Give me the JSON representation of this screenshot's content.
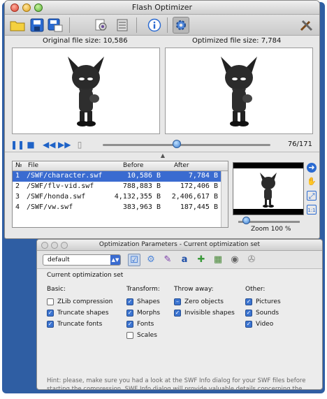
{
  "main_window": {
    "title": "Flash Optimizer",
    "toolbar": {
      "buttons": [
        {
          "name": "open-folder-icon",
          "glyph": "📂"
        },
        {
          "name": "save-icon",
          "glyph": "💾"
        },
        {
          "name": "save-as-icon",
          "glyph": "🖫"
        },
        {
          "name": "optimize-icon",
          "glyph": "⚙"
        },
        {
          "name": "batch-icon",
          "glyph": "🗎"
        },
        {
          "name": "info-icon",
          "glyph": "ℹ"
        },
        {
          "name": "settings-icon",
          "glyph": "⚙"
        },
        {
          "name": "tools-icon",
          "glyph": "🛠"
        }
      ]
    },
    "original_label": "Original file size: 10,586",
    "optimized_label": "Optimized file size: 7,784",
    "frame_counter": "76/171",
    "playback_progress": 0.44,
    "table": {
      "headers": [
        "№",
        "File",
        "Before",
        "After"
      ],
      "rows": [
        {
          "num": "1",
          "file": "/SWF/character.swf",
          "before": "10,586 B",
          "after": "7,784 B",
          "selected": true
        },
        {
          "num": "2",
          "file": "/SWF/flv-vid.swf",
          "before": "788,883 B",
          "after": "172,406 B",
          "selected": false
        },
        {
          "num": "3",
          "file": "/SWF/honda.swf",
          "before": "4,132,355 B",
          "after": "2,406,617 B",
          "selected": false
        },
        {
          "num": "4",
          "file": "/SWF/vw.swf",
          "before": "383,963 B",
          "after": "187,445 B",
          "selected": false
        }
      ]
    },
    "zoom_label": "Zoom 100 %",
    "zoom_level": 0.12
  },
  "opt_window": {
    "title": "Optimization Parameters - Current optimization set",
    "preset_value": "default",
    "set_title": "Current optimization set",
    "columns": {
      "basic": "Basic:",
      "transform": "Transform:",
      "throw_away": "Throw away:",
      "other": "Other:"
    },
    "basic": [
      {
        "label": "ZLib compression",
        "state": "off"
      },
      {
        "label": "Truncate shapes",
        "state": "on"
      },
      {
        "label": "Truncate fonts",
        "state": "on"
      }
    ],
    "transform": [
      {
        "label": "Shapes",
        "state": "on"
      },
      {
        "label": "Morphs",
        "state": "on"
      },
      {
        "label": "Fonts",
        "state": "on"
      },
      {
        "label": "Scales",
        "state": "off"
      }
    ],
    "throw_away": [
      {
        "label": "Zero objects",
        "state": "dash"
      },
      {
        "label": "Invisible shapes",
        "state": "on"
      }
    ],
    "other": [
      {
        "label": "Pictures",
        "state": "on"
      },
      {
        "label": "Sounds",
        "state": "on"
      },
      {
        "label": "Video",
        "state": "on"
      }
    ],
    "hint": "Hint: please, make sure you had a look at the SWF Info dialog for your SWF files before starting the compression. SWF Info dialog will provide valuable details concerning the contents of a movie. So you can decide upon which objects should be compressed, and which algorithms you want to enable."
  }
}
